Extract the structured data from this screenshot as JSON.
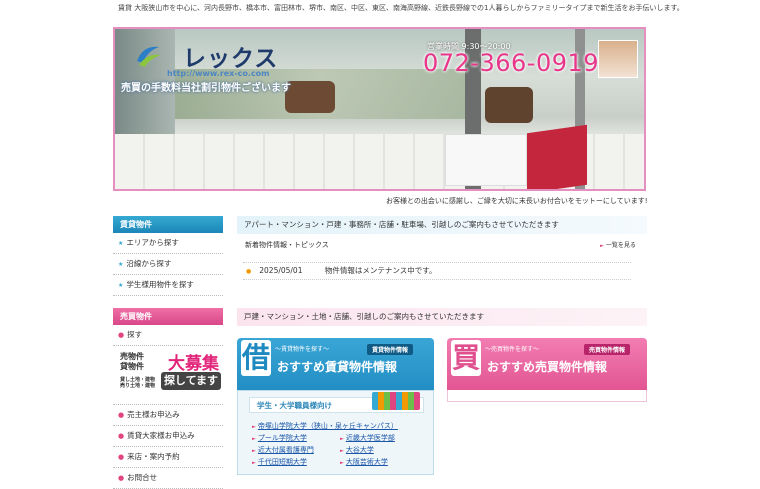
{
  "top_line": "賃貸 大阪狭山市を中心に、河内長野市、橋本市、富田林市、堺市、南区、中区、東区、南海高野線、近鉄長野線での1人暮らしからファミリータイプまで新生活をお手伝いします。",
  "header": {
    "logo_text": "レックス",
    "logo_url": "http://www.rex-co.com",
    "tagline": "売買の手数料当社割引物件ございます",
    "hours": "営業時間  9:30～20:00",
    "phone": "072-366-0919"
  },
  "motto": "お客様との出会いに感謝し、ご縁を大切に末長いお付合いをモットーにしています!",
  "sidebar": {
    "rent_head": "賃貸物件",
    "rent_items": [
      "エリアから探す",
      "沿線から探す",
      "学生様用物件を探す"
    ],
    "sale_head": "売買物件",
    "sale_items_top": [
      "探す"
    ],
    "banner": {
      "t1a": "売物件",
      "t1b": "貸物件",
      "t2a": "貸し土地・建物",
      "t2b": "売り土地・建物",
      "big": "大募集",
      "big2": "探してます"
    },
    "sale_items_bottom": [
      "売主様お申込み",
      "賃貸大家様お申込み",
      "来店・案内予約",
      "お問合せ"
    ]
  },
  "main": {
    "rent_bar": "アパート・マンション・戸建・事務所・店舗・駐車場、引越しのご案内もさせていただきます",
    "news_title": "新着物件情報・トピックス",
    "news_more": "一覧を見る",
    "news": [
      {
        "date": "2025/05/01",
        "text": "物件情報はメンテナンス中です。"
      }
    ],
    "sale_bar": "戸建・マンション・土地・店舗、引越しのご案内もさせていただきます"
  },
  "cards": {
    "rent": {
      "kanji": "借",
      "small": "～賃貸物件を探す～",
      "tag": "賃貸物件情報",
      "title": "おすすめ賃貸物件情報"
    },
    "sale": {
      "kanji": "買",
      "small": "～売買物件を探す～",
      "tag": "売買物件情報",
      "title": "おすすめ売買物件情報"
    }
  },
  "student": {
    "head": "学生・大学職員様向け",
    "links_left": [
      "帝塚山学院大学（狭山・泉ヶ丘キャンパス）",
      "プール学院大学",
      "近大付属看護専門",
      "千代田短期大学"
    ],
    "links_right": [
      "",
      "近畿大学医学部",
      "大谷大学",
      "大阪芸術大学"
    ]
  },
  "colors": {
    "accent_blue": "#1e8ac0",
    "accent_pink": "#e0508e",
    "phone": "#e8368a"
  }
}
